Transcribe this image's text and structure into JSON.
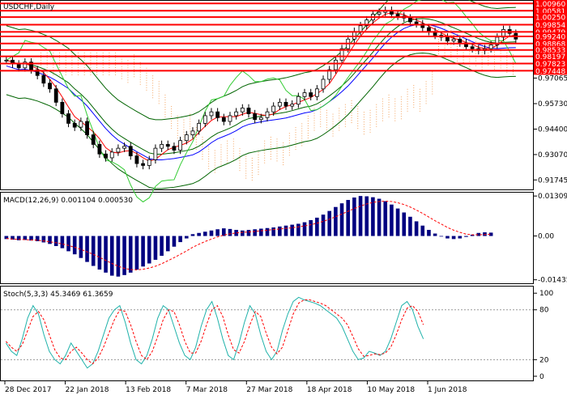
{
  "chart_data": [
    {
      "type": "candlestick",
      "title": "USDCHF,Daily",
      "y_ticks": [
        "0.97065",
        "0.95730",
        "0.94400",
        "0.93070",
        "0.91745"
      ],
      "ylim": [
        0.9125,
        1.011
      ],
      "x_ticks": [
        "28 Dec 2017",
        "22 Jan 2018",
        "13 Feb 2018",
        "7 Mar 2018",
        "27 Mar 2018",
        "18 Apr 2018",
        "10 May 2018",
        "1 Jun 2018"
      ],
      "close_path": [
        0.98,
        0.978,
        0.976,
        0.979,
        0.975,
        0.972,
        0.968,
        0.965,
        0.958,
        0.952,
        0.947,
        0.945,
        0.948,
        0.941,
        0.936,
        0.931,
        0.929,
        0.932,
        0.934,
        0.935,
        0.93,
        0.926,
        0.925,
        0.928,
        0.934,
        0.936,
        0.935,
        0.933,
        0.938,
        0.941,
        0.943,
        0.947,
        0.951,
        0.953,
        0.95,
        0.948,
        0.951,
        0.953,
        0.955,
        0.952,
        0.949,
        0.95,
        0.953,
        0.956,
        0.958,
        0.956,
        0.957,
        0.961,
        0.963,
        0.961,
        0.965,
        0.97,
        0.975,
        0.98,
        0.986,
        0.991,
        0.995,
        0.998,
        1.001,
        1.004,
        1.005,
        1.006,
        1.004,
        1.003,
        1.002,
        1.0,
        0.999,
        0.997,
        0.995,
        0.993,
        0.992,
        0.99,
        0.991,
        0.989,
        0.987,
        0.986,
        0.985,
        0.986,
        0.988,
        0.992,
        0.996,
        0.994,
        0.991
      ],
      "resistance_levels": [
        {
          "label": "1.00960",
          "value": 1.0096
        },
        {
          "label": "1.00581",
          "value": 1.00581
        },
        {
          "label": "1.00250",
          "value": 1.0025
        },
        {
          "label": "0.99854",
          "value": 0.99854
        },
        {
          "label": "0.99479",
          "value": 0.99479
        },
        {
          "label": "0.99240",
          "value": 0.9924
        },
        {
          "label": "0.98868",
          "value": 0.98868
        },
        {
          "label": "0.98533",
          "value": 0.98533
        },
        {
          "label": "0.98197",
          "value": 0.98197
        },
        {
          "label": "0.97823",
          "value": 0.97823
        },
        {
          "label": "0.97448",
          "value": 0.97448
        }
      ],
      "colors": {
        "resistance": "#ff0000",
        "bull": "#ffffff",
        "bear": "#000000",
        "ma_fast": "#ff0000",
        "ma_slow": "#0000ff",
        "bands": "#006400",
        "ma_lime": "#33cc33",
        "cloud": "#f4a460"
      }
    },
    {
      "type": "bar",
      "title": "MACD(12,26,9) 0.001104 0.000530",
      "y_ticks": [
        "0.013095",
        "0.00",
        "-0.01435"
      ],
      "ylim": [
        -0.0155,
        0.0142
      ],
      "values": [
        -0.001,
        -0.0012,
        -0.0014,
        -0.0013,
        -0.0015,
        -0.0017,
        -0.0021,
        -0.0026,
        -0.0033,
        -0.004,
        -0.005,
        -0.006,
        -0.0072,
        -0.0085,
        -0.0098,
        -0.011,
        -0.012,
        -0.013,
        -0.0133,
        -0.0128,
        -0.012,
        -0.011,
        -0.01,
        -0.009,
        -0.0078,
        -0.0065,
        -0.005,
        -0.0035,
        -0.002,
        -0.0008,
        0.0006,
        0.001,
        0.0014,
        0.0018,
        0.0022,
        0.0025,
        0.0023,
        0.002,
        0.0018,
        0.002,
        0.0022,
        0.0024,
        0.0026,
        0.0028,
        0.0031,
        0.0034,
        0.0037,
        0.004,
        0.0045,
        0.0052,
        0.006,
        0.007,
        0.0082,
        0.0095,
        0.0107,
        0.0118,
        0.0126,
        0.0131,
        0.013,
        0.0127,
        0.0122,
        0.0114,
        0.0103,
        0.009,
        0.0077,
        0.0063,
        0.0048,
        0.0034,
        0.002,
        0.0008,
        -0.0002,
        -0.0008,
        -0.001,
        -0.0008,
        -0.0003,
        0.0004,
        0.001,
        0.0012,
        0.0011
      ],
      "signal": [
        -0.0008,
        -0.001,
        -0.0011,
        -0.0012,
        -0.0013,
        -0.0014,
        -0.0016,
        -0.0019,
        -0.0022,
        -0.0026,
        -0.0031,
        -0.0037,
        -0.0044,
        -0.0052,
        -0.006,
        -0.007,
        -0.008,
        -0.009,
        -0.0099,
        -0.0106,
        -0.011,
        -0.0111,
        -0.0109,
        -0.0105,
        -0.0099,
        -0.0091,
        -0.0081,
        -0.0071,
        -0.006,
        -0.0049,
        -0.0037,
        -0.0027,
        -0.0018,
        -0.001,
        -0.0003,
        0.0003,
        0.0007,
        0.001,
        0.0012,
        0.0013,
        0.0015,
        0.0017,
        0.0019,
        0.0021,
        0.0023,
        0.0025,
        0.0027,
        0.003,
        0.0033,
        0.0037,
        0.0042,
        0.0048,
        0.0055,
        0.0063,
        0.0072,
        0.0081,
        0.009,
        0.0098,
        0.0105,
        0.011,
        0.0113,
        0.0114,
        0.0113,
        0.0109,
        0.0103,
        0.0095,
        0.0085,
        0.0074,
        0.0062,
        0.005,
        0.0039,
        0.0028,
        0.0019,
        0.0012,
        0.0006,
        0.0004,
        0.0004,
        0.0005,
        0.0005
      ],
      "colors": {
        "bars": "#000080",
        "signal": "#ff0000"
      }
    },
    {
      "type": "line",
      "title": "Stoch(5,3,3) 45.3469 61.3659",
      "y_ticks": [
        "100",
        "80",
        "20",
        "0"
      ],
      "ylim": [
        -5,
        108
      ],
      "levels": [
        80,
        20
      ],
      "series": [
        {
          "values": [
            40,
            30,
            25,
            45,
            70,
            85,
            75,
            50,
            30,
            20,
            15,
            25,
            40,
            30,
            20,
            10,
            15,
            30,
            50,
            70,
            80,
            85,
            65,
            40,
            20,
            15,
            25,
            45,
            70,
            85,
            80,
            60,
            40,
            25,
            20,
            35,
            60,
            80,
            90,
            70,
            45,
            25,
            20,
            40,
            65,
            85,
            75,
            50,
            30,
            20,
            30,
            55,
            75,
            90,
            95,
            92,
            90,
            88,
            85,
            80,
            75,
            70,
            60,
            45,
            30,
            20,
            22,
            30,
            28,
            25,
            30,
            45,
            65,
            85,
            90,
            80,
            60,
            45
          ]
        },
        {
          "values": [
            42,
            35,
            30,
            38,
            55,
            72,
            78,
            68,
            50,
            32,
            22,
            20,
            30,
            35,
            28,
            20,
            15,
            22,
            35,
            52,
            68,
            80,
            78,
            62,
            42,
            25,
            20,
            30,
            48,
            68,
            80,
            78,
            62,
            42,
            28,
            28,
            42,
            62,
            80,
            85,
            72,
            50,
            32,
            28,
            42,
            62,
            78,
            72,
            52,
            35,
            27,
            35,
            55,
            75,
            88,
            92,
            92,
            90,
            88,
            85,
            80,
            75,
            70,
            62,
            48,
            33,
            24,
            25,
            27,
            26,
            28,
            35,
            50,
            68,
            82,
            85,
            78,
            62
          ]
        }
      ],
      "colors": {
        "main": "#20b2aa",
        "signal": "#ff0000"
      }
    }
  ]
}
